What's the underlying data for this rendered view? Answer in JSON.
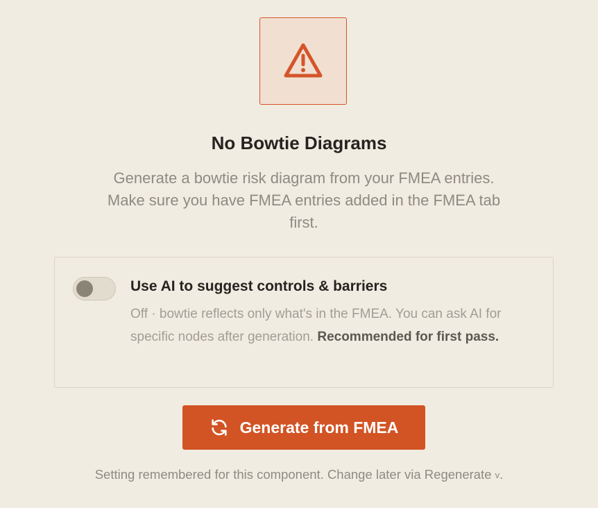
{
  "empty_state": {
    "icon": "warning-triangle-icon",
    "title": "No Bowtie Diagrams",
    "description": "Generate a bowtie risk diagram from your FMEA entries. Make sure you have FMEA entries added in the FMEA tab first."
  },
  "ai_option": {
    "toggle_state": "off",
    "heading": "Use AI to suggest controls & barriers",
    "body_text": "Off · bowtie reflects only what's in the FMEA. You can ask AI for specific nodes after generation.",
    "body_emphasis": "Recommended for first pass."
  },
  "generate_button": {
    "icon": "refresh-icon",
    "label": "Generate from FMEA"
  },
  "footer": {
    "text": "Setting remembered for this component. Change later via Regenerate",
    "chevron": "v",
    "end": "."
  },
  "colors": {
    "background": "#f1ece1",
    "accent": "#d25324",
    "icon_box_fill": "#f1dfd1",
    "title_text": "#262320",
    "muted_text": "#8e8a83"
  }
}
